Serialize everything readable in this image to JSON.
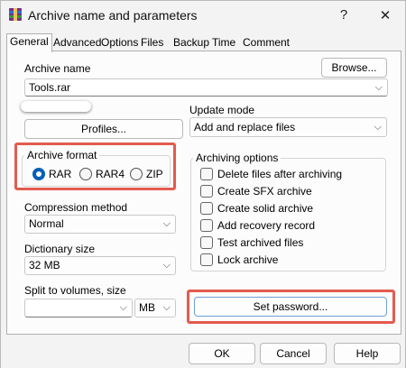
{
  "window": {
    "title": "Archive name and parameters",
    "help_glyph": "?",
    "close_glyph": "✕",
    "icon": "winrar-icon"
  },
  "tabs": [
    {
      "label": "General",
      "active": true
    },
    {
      "label": "Advanced"
    },
    {
      "label": "Options"
    },
    {
      "label": "Files"
    },
    {
      "label": "Backup"
    },
    {
      "label": "Time"
    },
    {
      "label": "Comment"
    }
  ],
  "archive_name": {
    "label": "Archive name",
    "value": "Tools.rar",
    "browse_button": "Browse..."
  },
  "profiles_button": "Profiles...",
  "update_mode": {
    "label": "Update mode",
    "value": "Add and replace files"
  },
  "archive_format": {
    "label": "Archive format",
    "options": [
      "RAR",
      "RAR4",
      "ZIP"
    ],
    "selected": "RAR"
  },
  "archiving_options": {
    "label": "Archiving options",
    "items": [
      "Delete files after archiving",
      "Create SFX archive",
      "Create solid archive",
      "Add recovery record",
      "Test archived files",
      "Lock archive"
    ]
  },
  "compression_method": {
    "label": "Compression method",
    "value": "Normal"
  },
  "dictionary_size": {
    "label": "Dictionary size",
    "value": "32 MB"
  },
  "split_volumes": {
    "label": "Split to volumes, size",
    "value": "",
    "unit": "MB"
  },
  "set_password_button": "Set password...",
  "footer": {
    "ok": "OK",
    "cancel": "Cancel",
    "help": "Help"
  },
  "highlight_color": "#e35b4f",
  "accent_color": "#005fb8"
}
